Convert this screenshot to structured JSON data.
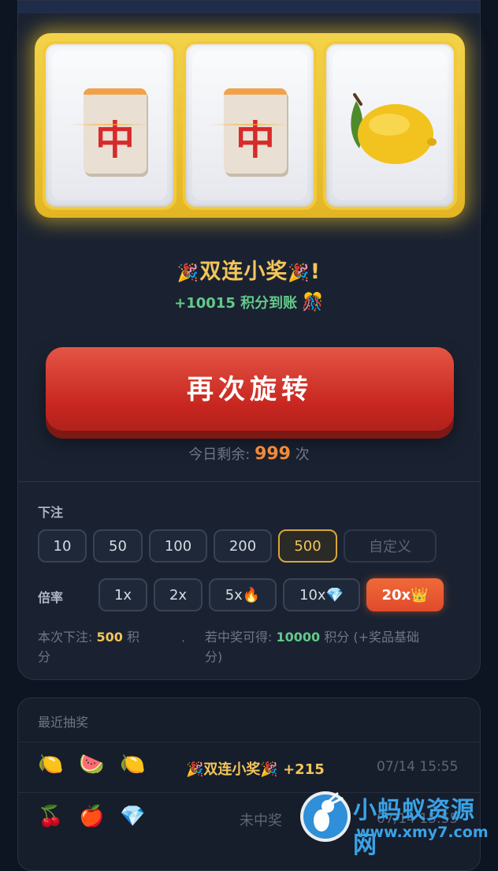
{
  "reels": [
    {
      "symbol": "mahjong-red-dragon",
      "glyph": "中"
    },
    {
      "symbol": "mahjong-red-dragon",
      "glyph": "中"
    },
    {
      "symbol": "lemon",
      "glyph": "🍋"
    }
  ],
  "result": {
    "title": "双连小奖",
    "exclamation": "!",
    "party_icon": "🎉",
    "points_line": "+10015 积分到账",
    "confetti_icon": "🎊"
  },
  "spin_button": {
    "label": "再次旋转"
  },
  "remaining": {
    "prefix": "今日剩余:",
    "count": "999",
    "suffix": "次"
  },
  "bet": {
    "label": "下注",
    "options": [
      "10",
      "50",
      "100",
      "200",
      "500"
    ],
    "selected": "500",
    "custom_label": "自定义"
  },
  "multiplier": {
    "label": "倍率",
    "options": [
      "1x",
      "2x",
      "5x🔥",
      "10x💎",
      "20x👑"
    ],
    "selected": "20x👑"
  },
  "summary": {
    "bet_prefix": "本次下注:",
    "bet_value": "500",
    "bet_unit": "积",
    "bet_unit_wrap": "分",
    "dot": "·",
    "win_prefix": "若中奖可得:",
    "win_value": "10000",
    "win_unit": "积分",
    "win_note": "(+奖品基础",
    "win_note_wrap": "分)"
  },
  "recent": {
    "title": "最近抽奖",
    "rows": [
      {
        "symbols": [
          "🍋",
          "🍉",
          "🍋"
        ],
        "result": "🎉双连小奖🎉 +215",
        "time": "07/14 15:55"
      },
      {
        "symbols": [
          "🍒",
          "🍎",
          "💎"
        ],
        "result": "未中奖",
        "time": "07/14 15:55"
      }
    ]
  },
  "watermark": {
    "name": "小蚂蚁资源网",
    "url": "www.xmy7.com"
  },
  "colors": {
    "background": "#0d1422",
    "card": "#1a2231",
    "gold": "#f3c55a",
    "green": "#64c98a",
    "spin_red": "#d63a30",
    "accent_orange": "#f08a3a",
    "watermark_blue": "#3aa2e6"
  }
}
